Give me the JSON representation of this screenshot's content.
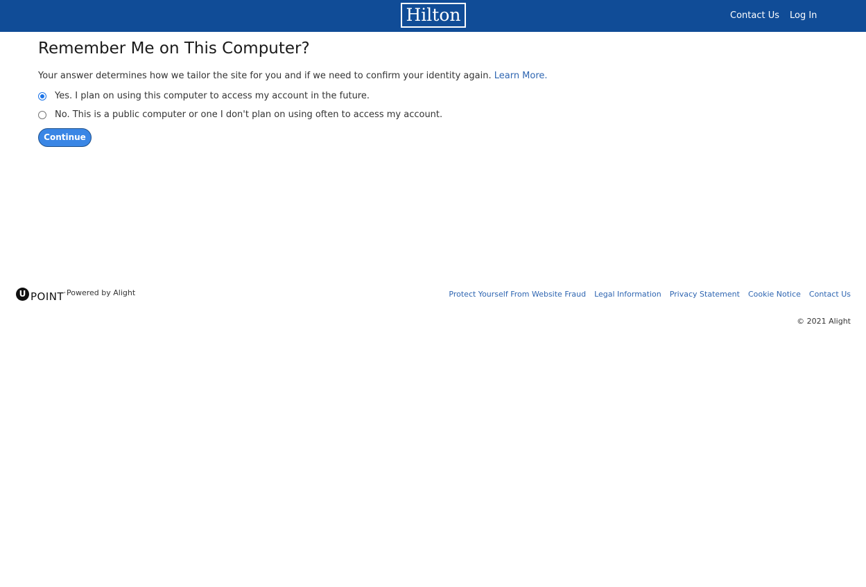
{
  "header": {
    "logo": "Hilton",
    "nav": {
      "contact_us": "Contact Us",
      "log_in": "Log In"
    }
  },
  "main": {
    "title": "Remember Me on This Computer?",
    "intro": "Your answer determines how we tailor the site for you and if we need to confirm your identity again.",
    "learn_more": "Learn More.",
    "options": [
      {
        "label": "Yes. I plan on using this computer to access my account in the future.",
        "selected": true
      },
      {
        "label": "No. This is a public computer or one I don't plan on using often to access my account.",
        "selected": false
      }
    ],
    "continue_label": "Continue"
  },
  "footer": {
    "brand_letter": "U",
    "brand_text": "POINT",
    "brand_mark": "'",
    "powered_by": "Powered by Alight",
    "links": [
      "Protect Yourself From Website Fraud",
      "Legal Information",
      "Privacy Statement",
      "Cookie Notice",
      "Contact Us"
    ],
    "copyright": "© 2021 Alight"
  },
  "colors": {
    "header_bg": "#104c97",
    "link": "#2e65b1",
    "button_bg": "#3a86e5"
  }
}
